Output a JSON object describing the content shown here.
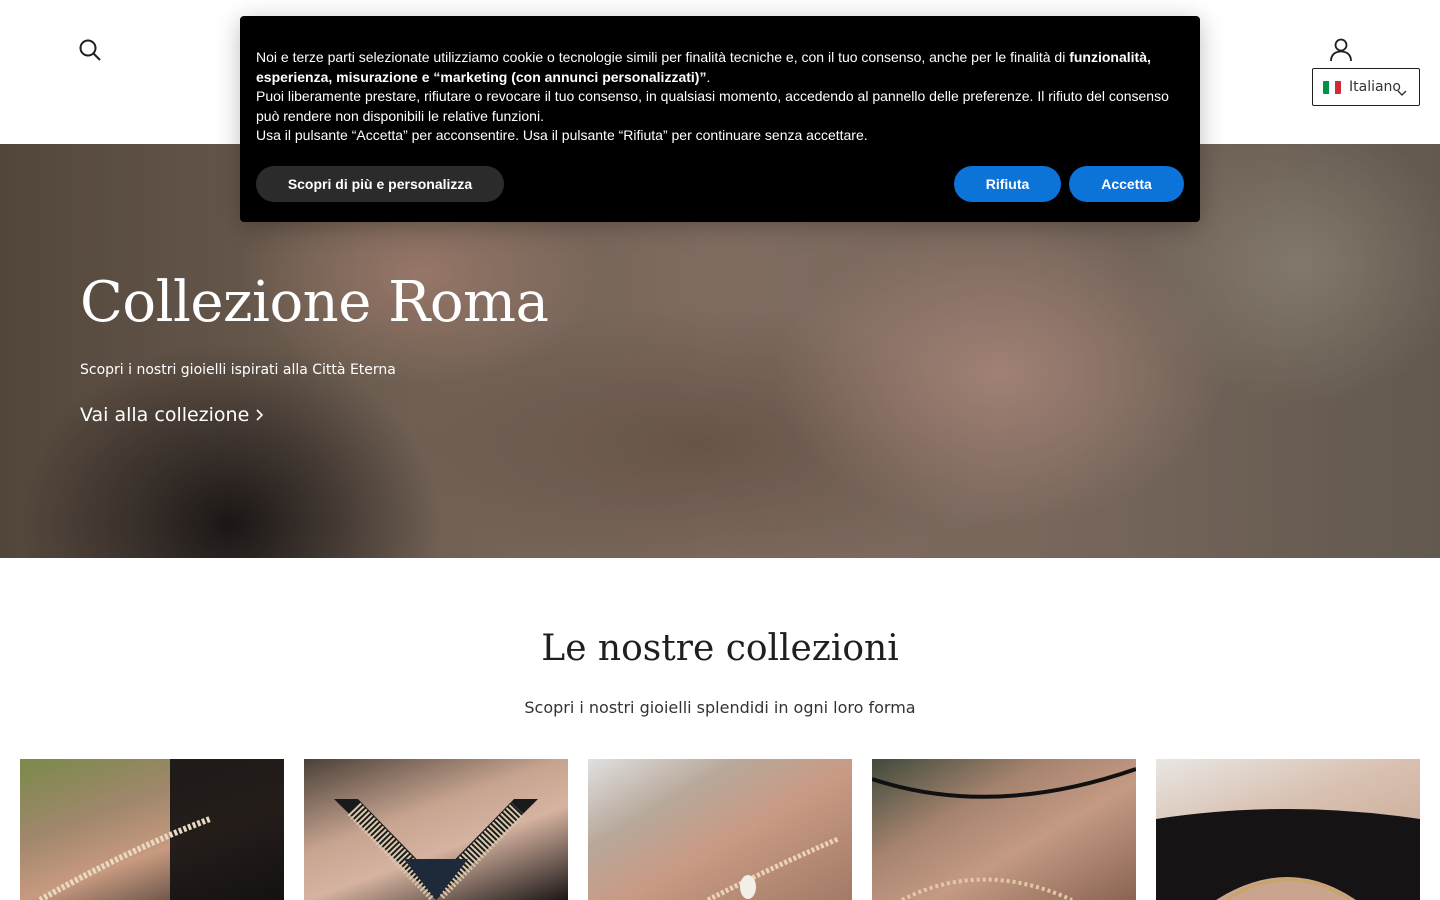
{
  "header": {
    "language": {
      "selected": "Italiano",
      "flag_colors": [
        "#009246",
        "#ffffff",
        "#ce2b37"
      ]
    }
  },
  "hero": {
    "title": "Collezione Roma",
    "subtitle": "Scopri i nostri gioielli ispirati alla Città Eterna",
    "link_label": "Vai alla collezione"
  },
  "collections": {
    "title": "Le nostre collezioni",
    "subtitle": "Scopri i nostri gioielli splendidi in ogni loro forma",
    "cards": [
      {
        "name": "collection-card-1"
      },
      {
        "name": "collection-card-2"
      },
      {
        "name": "collection-card-3"
      },
      {
        "name": "collection-card-4"
      },
      {
        "name": "collection-card-5"
      }
    ]
  },
  "cookie_banner": {
    "paragraph1_start": "Noi e terze parti selezionate utilizziamo cookie o tecnologie simili per finalità tecniche e, con il tuo consenso, anche per le finalità di ",
    "paragraph1_bold": "funzionalità, esperienza, misurazione e “marketing (con annunci personalizzati)”",
    "paragraph1_end": ".",
    "paragraph2": "Puoi liberamente prestare, rifiutare o revocare il tuo consenso, in qualsiasi momento, accedendo al pannello delle preferenze. Il rifiuto del consenso può rendere non disponibili le relative funzioni.",
    "paragraph3": "Usa il pulsante “Accetta” per acconsentire. Usa il pulsante “Rifiuta” per continuare senza accettare.",
    "customize_label": "Scopri di più e personalizza",
    "reject_label": "Rifiuta",
    "accept_label": "Accetta",
    "button_color": "#0c73d9"
  }
}
